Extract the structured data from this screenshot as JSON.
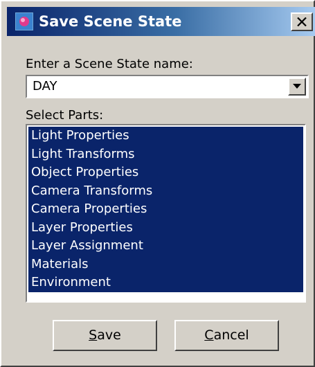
{
  "window": {
    "title": "Save Scene State",
    "icon": "scene-state-icon",
    "close_icon": "close-icon"
  },
  "name_field": {
    "label": "Enter a Scene State name:",
    "value": "DAY"
  },
  "parts": {
    "label": "Select Parts:",
    "items": [
      "Light Properties",
      "Light Transforms",
      "Object Properties",
      "Camera Transforms",
      "Camera Properties",
      "Layer Properties",
      "Layer Assignment",
      "Materials",
      "Environment"
    ]
  },
  "buttons": {
    "save": {
      "mnemonic": "S",
      "rest": "ave"
    },
    "cancel": {
      "mnemonic": "C",
      "rest": "ancel"
    }
  },
  "colors": {
    "dialog_face": "#d4d0c8",
    "title_active": "#0a246a",
    "selection": "#0a246a",
    "selection_text": "#ffffff"
  }
}
